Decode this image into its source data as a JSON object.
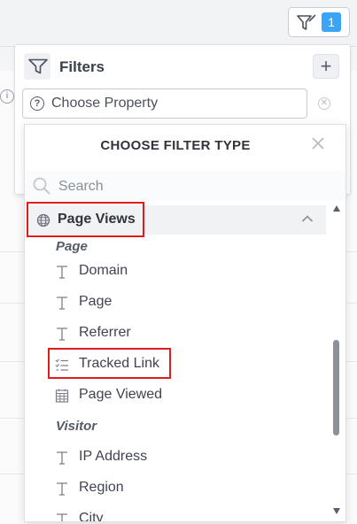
{
  "toolbar": {
    "filter_button_icon": "filter-icon",
    "filter_count": "1",
    "badge_color": "#3aa4f6"
  },
  "filters_panel": {
    "title": "Filters",
    "add_icon": "plus-icon",
    "property_placeholder": "Choose Property",
    "clear_icon": "clear-circle-icon"
  },
  "dropdown": {
    "title": "CHOOSE FILTER TYPE",
    "search_placeholder": "Search",
    "group": {
      "label": "Page Views",
      "icon": "globe-icon",
      "expanded": true
    },
    "sections": [
      {
        "label": "Page",
        "items": [
          {
            "label": "Domain",
            "icon": "text-type-icon"
          },
          {
            "label": "Page",
            "icon": "text-type-icon"
          },
          {
            "label": "Referrer",
            "icon": "text-type-icon"
          },
          {
            "label": "Tracked Link",
            "icon": "list-type-icon",
            "highlighted": true
          },
          {
            "label": "Page Viewed",
            "icon": "calendar-type-icon"
          }
        ]
      },
      {
        "label": "Visitor",
        "items": [
          {
            "label": "IP Address",
            "icon": "text-type-icon"
          },
          {
            "label": "Region",
            "icon": "text-type-icon"
          },
          {
            "label": "City",
            "icon": "text-type-icon"
          }
        ]
      }
    ],
    "highlight_color": "#e01d1d"
  }
}
